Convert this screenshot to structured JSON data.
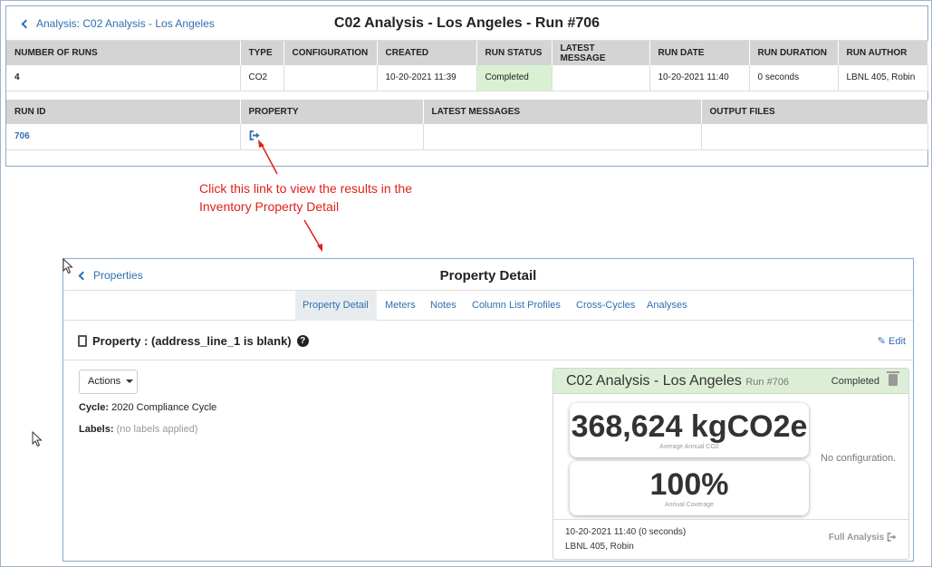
{
  "top": {
    "back_label": "Analysis: C02 Analysis - Los Angeles",
    "title": "C02 Analysis - Los Angeles - Run #706",
    "table1": {
      "headers": [
        "NUMBER OF RUNS",
        "TYPE",
        "CONFIGURATION",
        "CREATED",
        "RUN STATUS",
        "LATEST MESSAGE",
        "RUN DATE",
        "RUN DURATION",
        "RUN AUTHOR"
      ],
      "row": [
        "4",
        "CO2",
        "",
        "10-20-2021 11:39",
        "Completed",
        "",
        "10-20-2021 11:40",
        "0 seconds",
        "LBNL 405, Robin"
      ]
    },
    "table2": {
      "headers": [
        "RUN ID",
        "PROPERTY",
        "LATEST MESSAGES",
        "OUTPUT FILES"
      ],
      "row": [
        "706",
        "",
        "",
        ""
      ]
    }
  },
  "annotation": {
    "line1": "Click this link to view the results in the",
    "line2": "Inventory Property Detail"
  },
  "bottom": {
    "back_label": "Properties",
    "title": "Property Detail",
    "tabs": [
      "Property Detail",
      "Meters",
      "Notes",
      "Column List Profiles",
      "Cross-Cycles",
      "Analyses"
    ],
    "active_tab": "Property Detail",
    "property_heading": "Property : (address_line_1 is blank)",
    "edit_label": "Edit",
    "actions_label": "Actions",
    "cycle_label": "Cycle:",
    "cycle_value": "2020 Compliance Cycle",
    "labels_label": "Labels:",
    "labels_value": "(no labels applied)",
    "card": {
      "title": "C02 Analysis - Los Angeles",
      "run": "Run #706",
      "status": "Completed",
      "metric1_value": "368,624 kgCO2e",
      "metric1_label": "Average Annual CO2",
      "metric2_value": "100%",
      "metric2_label": "Annual Coverage",
      "no_config": "No configuration.",
      "footer_date": "10-20-2021 11:40 (0 seconds)",
      "footer_author": "LBNL 405, Robin",
      "full_analysis": "Full Analysis"
    }
  },
  "colors": {
    "link": "#2f6fb0",
    "header_gray": "#d4d4d4",
    "status_green": "#d9f0d3",
    "annotation_red": "#e0201a",
    "panel_border": "#8fa9c6"
  }
}
